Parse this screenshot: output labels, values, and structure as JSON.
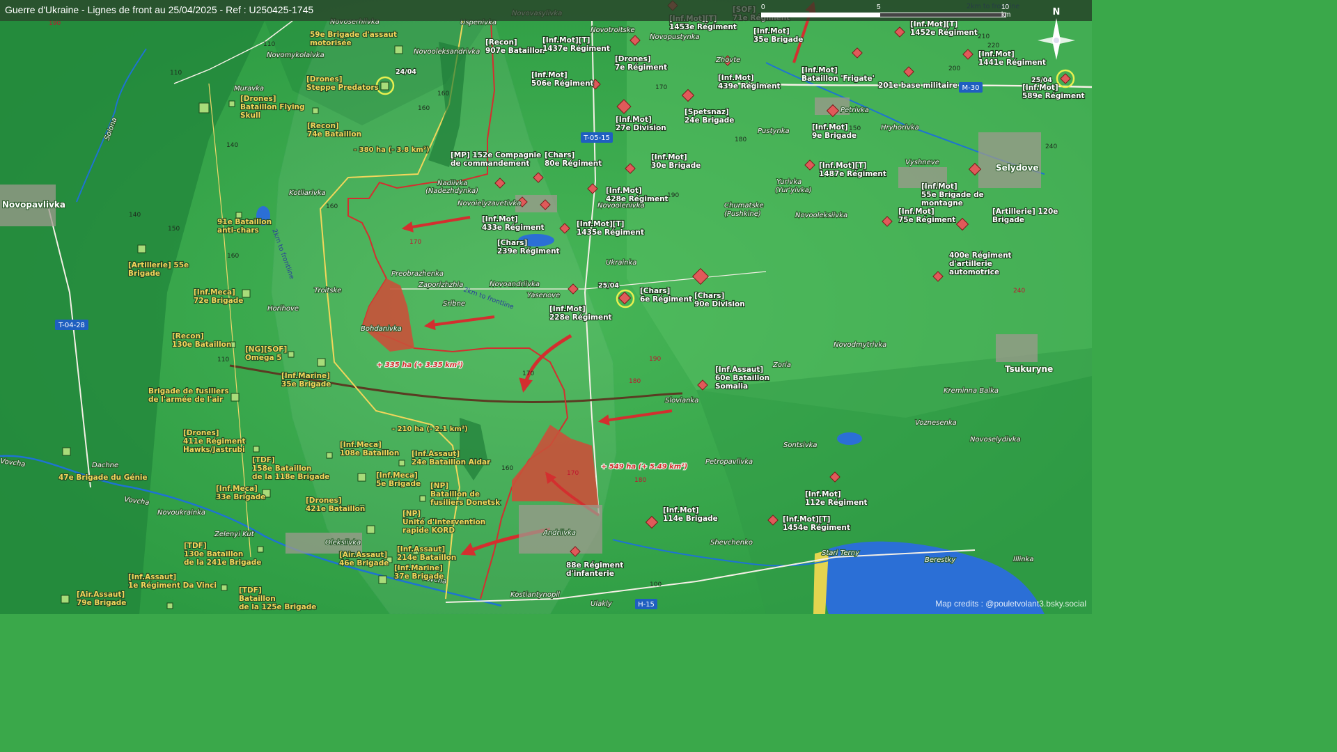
{
  "title": "Guerre d'Ukraine - Lignes de front au 25/04/2025 - Ref : U250425-1745",
  "credits": "Map credits : @pouletvolant3.bsky.social",
  "scale": {
    "zero": "0",
    "mid": "5",
    "end": "10 km"
  },
  "compass": "N",
  "colors": {
    "terrain": "#3aa84a",
    "dark_terrain": "#1f7d3b",
    "front_red": "#c62828",
    "gain_fill": "#c9513a",
    "unit_yellow": "#f2d65b",
    "river": "#1e73d2"
  },
  "towns": [
    {
      "name": "Novoserhiivka"
    },
    {
      "name": "Uspenivka"
    },
    {
      "name": "Novovasylivka"
    },
    {
      "name": "Novotroitske"
    },
    {
      "name": "Novopustynka"
    },
    {
      "name": "Novomykolaivka"
    },
    {
      "name": "Novooleksandrivka"
    },
    {
      "name": "Muravka"
    },
    {
      "name": "Zhovte"
    },
    {
      "name": "Petrivka"
    },
    {
      "name": "Hryhorivka"
    },
    {
      "name": "Pustynka"
    },
    {
      "name": "Vyshneve"
    },
    {
      "name": "Selydove"
    },
    {
      "name": "Yurivka"
    },
    {
      "name": "(Yur'yivka)"
    },
    {
      "name": "Nadiivka"
    },
    {
      "name": "(Nadezhdynka)"
    },
    {
      "name": "Kotliarivka"
    },
    {
      "name": "Novoielyzavetivka"
    },
    {
      "name": "Novoolenivka"
    },
    {
      "name": "Chumatske"
    },
    {
      "name": "(Pushkine)"
    },
    {
      "name": "Novooleksiivka"
    },
    {
      "name": "Novopavlivka"
    },
    {
      "name": "Ukrainka"
    },
    {
      "name": "Preobrazhenka"
    },
    {
      "name": "Zaporizhzhia"
    },
    {
      "name": "Novoandriivka"
    },
    {
      "name": "Yasenove"
    },
    {
      "name": "Troitske"
    },
    {
      "name": "Horihove"
    },
    {
      "name": "Sribne"
    },
    {
      "name": "Bohdanivka"
    },
    {
      "name": "Novodmytrivka"
    },
    {
      "name": "Zoria"
    },
    {
      "name": "Tsukuryne"
    },
    {
      "name": "Kreminna Balka"
    },
    {
      "name": "Slovianka"
    },
    {
      "name": "Voznesenka"
    },
    {
      "name": "Novoselydivka"
    },
    {
      "name": "Sontsivka"
    },
    {
      "name": "Petropavlivka"
    },
    {
      "name": "Dachne"
    },
    {
      "name": "Novoukrainka"
    },
    {
      "name": "Zelenyi Kut"
    },
    {
      "name": "Oleksiivka"
    },
    {
      "name": "Andriivka"
    },
    {
      "name": "Shevchenko"
    },
    {
      "name": "Stari Terny"
    },
    {
      "name": "Berestky"
    },
    {
      "name": "Illinka"
    },
    {
      "name": "Kostiantynopil"
    },
    {
      "name": "Ulakly"
    },
    {
      "name": "Vovcha"
    },
    {
      "name": "Vovcha"
    },
    {
      "name": "Vovcha"
    },
    {
      "name": "Solona"
    }
  ],
  "roads": [
    {
      "label": "T-05-15"
    },
    {
      "label": "M-30"
    },
    {
      "label": "T-04-28"
    },
    {
      "label": "H-15"
    }
  ],
  "elevations": [
    "190",
    "110",
    "110",
    "160",
    "160",
    "140",
    "150",
    "140",
    "160",
    "160",
    "170",
    "170",
    "180",
    "190",
    "200",
    "210",
    "220",
    "240",
    "240",
    "190",
    "180",
    "170",
    "160",
    "170",
    "180",
    "110",
    "100",
    "150"
  ],
  "ukr_units": [
    {
      "l1": "59e Brigade d'assaut",
      "l2": "motorisée"
    },
    {
      "l1": "[Drones]",
      "l2": "Steppe Predators"
    },
    {
      "l1": "[Drones]",
      "l2": "Bataillon Flying",
      "l3": "Skull"
    },
    {
      "l1": "[Recon]",
      "l2": "74e Bataillon"
    },
    {
      "l1": "91e Bataillon",
      "l2": "anti-chars"
    },
    {
      "l1": "[Artillerie] 55e",
      "l2": "Brigade"
    },
    {
      "l1": "[Inf.Meca]",
      "l2": "72e Brigade"
    },
    {
      "l1": "[Recon]",
      "l2": "130e Bataillon"
    },
    {
      "l1": "[NG][SOF]",
      "l2": "Omega 5"
    },
    {
      "l1": "[Inf.Marine]",
      "l2": "35e Brigade"
    },
    {
      "l1": "Brigade de fusiliers",
      "l2": "de l'armée de l'air"
    },
    {
      "l1": "[Drones]",
      "l2": "411e Régiment",
      "l3": "Hawks/Jastrubi"
    },
    {
      "l1": "[Inf.Meca]",
      "l2": "108e Bataillon"
    },
    {
      "l1": "[Inf.Assaut]",
      "l2": "24e Bataillon Aidar"
    },
    {
      "l1": "[TDF]",
      "l2": "158e Bataillon",
      "l3": "de la 118e Brigade"
    },
    {
      "l1": "[Inf.Meca]",
      "l2": "5e Brigade"
    },
    {
      "l1": "47e Brigade du Génie"
    },
    {
      "l1": "[Inf.Meca]",
      "l2": "33e Brigade"
    },
    {
      "l1": "[NP]",
      "l2": "Bataillon de",
      "l3": "fusiliers Donetsk"
    },
    {
      "l1": "[Drones]",
      "l2": "421e Bataillon"
    },
    {
      "l1": "[NP]",
      "l2": "Unité d'intervention",
      "l3": "rapide KORD"
    },
    {
      "l1": "[TDF]",
      "l2": "130e Bataillon",
      "l3": "de la 241e Brigade"
    },
    {
      "l1": "[Air.Assaut]",
      "l2": "46e Brigade"
    },
    {
      "l1": "[Inf.Assaut]",
      "l2": "214e Bataillon"
    },
    {
      "l1": "[Inf.Assaut]",
      "l2": "1e Régiment Da Vinci"
    },
    {
      "l1": "[Inf.Marine]",
      "l2": "37e Brigade"
    },
    {
      "l1": "[Air.Assaut]",
      "l2": "79e Brigade"
    },
    {
      "l1": "[TDF]",
      "l2": "Bataillon",
      "l3": "de la 125e Brigade"
    }
  ],
  "rus_units": [
    {
      "l1": "[Inf.Mot][T]",
      "l2": "1453e Régiment"
    },
    {
      "l1": "[SOF]",
      "l2": "71e Régiment"
    },
    {
      "l1": "[Inf.Mot][T]",
      "l2": "1452e Régiment"
    },
    {
      "l1": "[Inf.Mot]",
      "l2": "35e Brigade"
    },
    {
      "l1": "[Recon]",
      "l2": "907e Bataillon"
    },
    {
      "l1": "[Inf.Mot][T]",
      "l2": "1437e Régiment"
    },
    {
      "l1": "[Inf.Mot]",
      "l2": "1441e Régiment"
    },
    {
      "l1": "[Drones]",
      "l2": "7e Régiment"
    },
    {
      "l1": "[Inf.Mot]",
      "l2": "506e Régiment"
    },
    {
      "l1": "[Inf.Mot]",
      "l2": "439e Régiment"
    },
    {
      "l1": "[Inf.Mot]",
      "l2": "Bataillon 'Frigate'"
    },
    {
      "l1": "201e base militaire"
    },
    {
      "l1": "[Inf.Mot]",
      "l2": "589e Régiment"
    },
    {
      "l1": "[Inf.Mot]",
      "l2": "27e Division"
    },
    {
      "l1": "[Spetsnaz]",
      "l2": "24e Brigade"
    },
    {
      "l1": "[Inf.Mot]",
      "l2": "9e Brigade"
    },
    {
      "l1": "[MP] 152e Compagnie",
      "l2": "de commandement"
    },
    {
      "l1": "[Chars]",
      "l2": "80e Régiment"
    },
    {
      "l1": "[Inf.Mot]",
      "l2": "30e Brigade"
    },
    {
      "l1": "[Inf.Mot][T]",
      "l2": "1487e Régiment"
    },
    {
      "l1": "[Inf.Mot]",
      "l2": "428e Régiment"
    },
    {
      "l1": "[Inf.Mot]",
      "l2": "55e Brigade de",
      "l3": "montagne"
    },
    {
      "l1": "[Inf.Mot]",
      "l2": "433e Régiment"
    },
    {
      "l1": "[Inf.Mot][T]",
      "l2": "1435e Régiment"
    },
    {
      "l1": "[Inf.Mot]",
      "l2": "75e Régiment"
    },
    {
      "l1": "[Artillerie] 120e",
      "l2": "Brigade"
    },
    {
      "l1": "[Chars]",
      "l2": "239e Régiment"
    },
    {
      "l1": "400e Régiment",
      "l2": "d'artillerie",
      "l3": "automotrice"
    },
    {
      "l1": "[Chars]",
      "l2": "6e Régiment"
    },
    {
      "l1": "[Chars]",
      "l2": "90e Division"
    },
    {
      "l1": "[Inf.Mot]",
      "l2": "228e Régiment"
    },
    {
      "l1": "[Inf.Assaut]",
      "l2": "60e Bataillon",
      "l3": "Somalia"
    },
    {
      "l1": "[Inf.Mot]",
      "l2": "112e Régiment"
    },
    {
      "l1": "[Inf.Mot]",
      "l2": "114e Brigade"
    },
    {
      "l1": "[Inf.Mot][T]",
      "l2": "1454e Régiment"
    },
    {
      "l1": "88e Régiment",
      "l2": "d'infanterie"
    }
  ],
  "changes": [
    {
      "label": "- 380 ha (- 3.8 km²)"
    },
    {
      "label": "+ 335 ha (+ 3.35 km²)"
    },
    {
      "label": "- 210 ha (- 2.1 km²)"
    },
    {
      "label": "+ 549 ha (+ 5.49 km²)"
    }
  ],
  "dates": [
    "24/04",
    "25/04",
    "25/04"
  ],
  "frontline_notes": [
    "2km to frontline",
    "2km to frontline",
    "2km to frontline"
  ]
}
